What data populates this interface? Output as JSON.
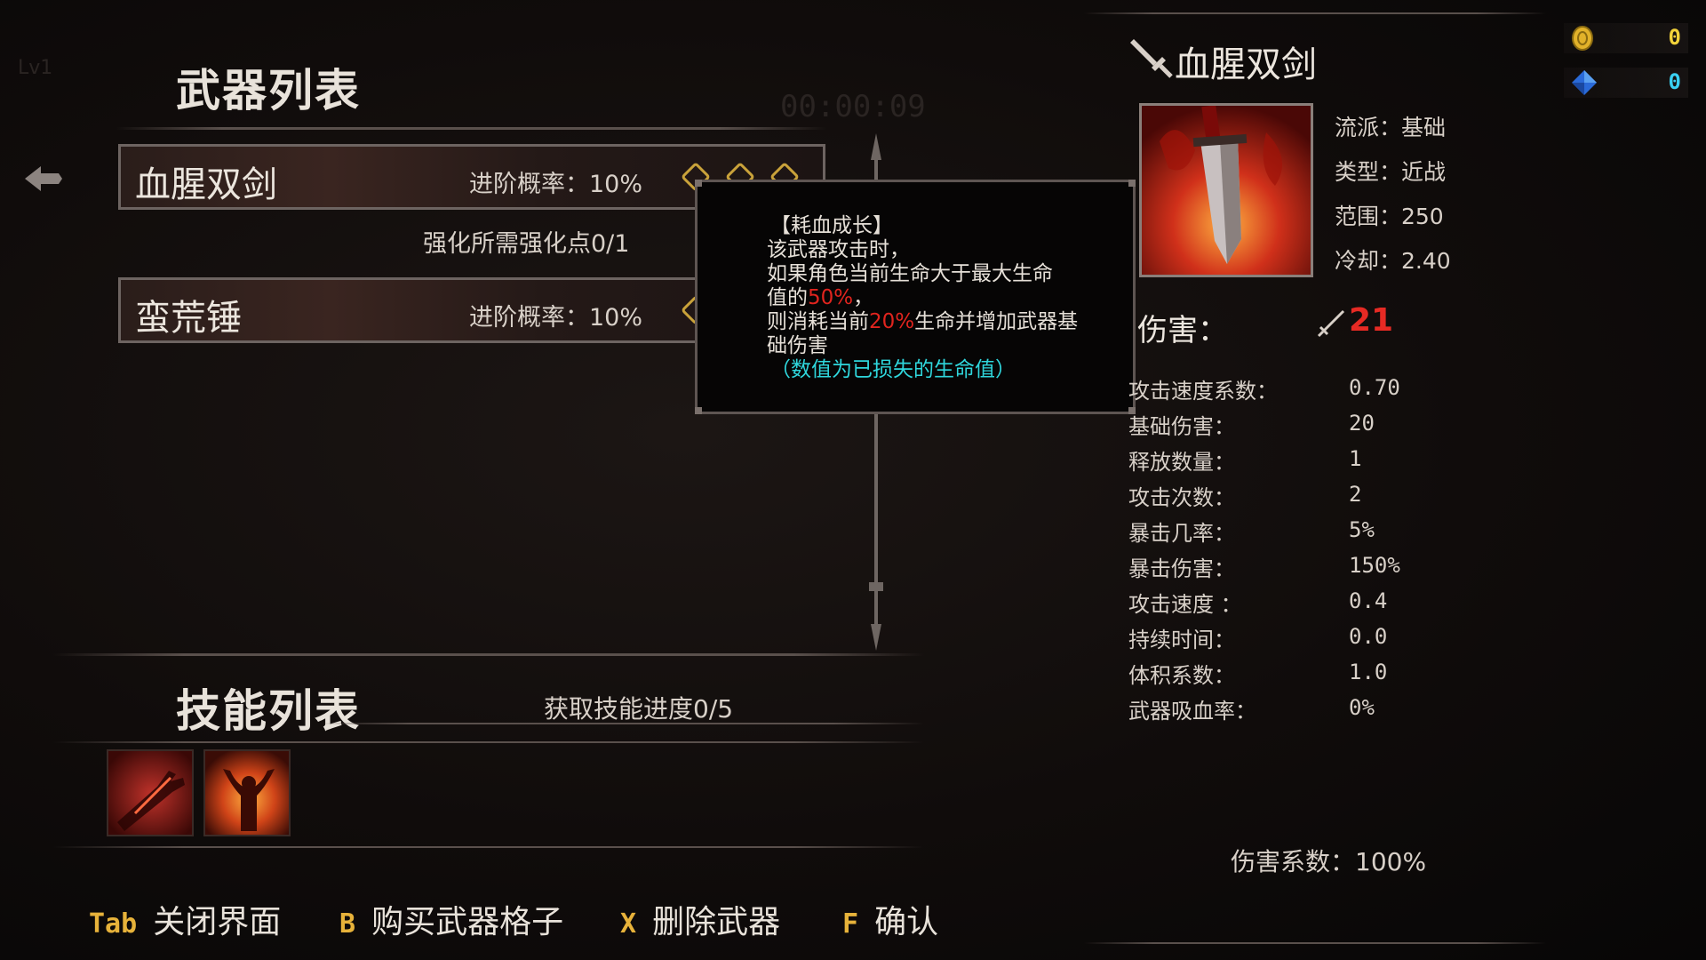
{
  "weapon_list": {
    "title": "武器列表",
    "weapons": [
      {
        "name": "血腥双剑",
        "chance": "进阶概率：10%",
        "gems": 3
      },
      {
        "name": "蛮荒锤",
        "chance": "进阶概率：10%",
        "gems": 2
      }
    ],
    "upgrade_points": "强化所需强化点0/1"
  },
  "tooltip": {
    "title": "【耗血成长】",
    "line1": "该武器攻击时，",
    "line2": "如果角色当前生命大于最大生命",
    "line3_prefix": "值的",
    "line3_red": "50%",
    "line3_suffix": "，",
    "line4_prefix": "则消耗当前",
    "line4_red": "20%",
    "line4_suffix": "生命并增加武器基",
    "line5": "础伤害",
    "note": "（数值为已损失的生命值）"
  },
  "skill_list": {
    "title": "技能列表",
    "progress": "获取技能进度0/5",
    "icons": [
      "bleeding-arm-skill-icon",
      "rage-flame-skill-icon"
    ]
  },
  "hints": [
    {
      "key": "Tab",
      "label": "关闭界面"
    },
    {
      "key": "B",
      "label": "购买武器格子"
    },
    {
      "key": "X",
      "label": "删除武器"
    },
    {
      "key": "F",
      "label": "确认"
    }
  ],
  "detail": {
    "name": "血腥双剑",
    "school": "流派：基础",
    "type": "类型：近战",
    "range": "范围：250",
    "cooldown": "冷却：2.40",
    "damage_label": "伤害：",
    "damage_value": "21",
    "stats": [
      {
        "label": "攻击速度系数：",
        "value": "0.70"
      },
      {
        "label": "基础伤害：",
        "value": "20"
      },
      {
        "label": "释放数量：",
        "value": "1"
      },
      {
        "label": "攻击次数：",
        "value": "2"
      },
      {
        "label": "暴击几率：",
        "value": "5%"
      },
      {
        "label": "暴击伤害：",
        "value": "150%"
      },
      {
        "label": "攻击速度 ：",
        "value": "0.4"
      },
      {
        "label": "持续时间：",
        "value": "0.0"
      },
      {
        "label": "体积系数：",
        "value": "1.0"
      },
      {
        "label": "武器吸血率：",
        "value": "0%"
      }
    ],
    "damage_coefficient": "伤害系数：100%"
  },
  "currency": {
    "gold": "0",
    "gem": "0",
    "gold_color": "#f2d23a",
    "gem_color": "#3ad0f2"
  },
  "background": {
    "level": "Lv1",
    "timer": "00:00:09"
  }
}
